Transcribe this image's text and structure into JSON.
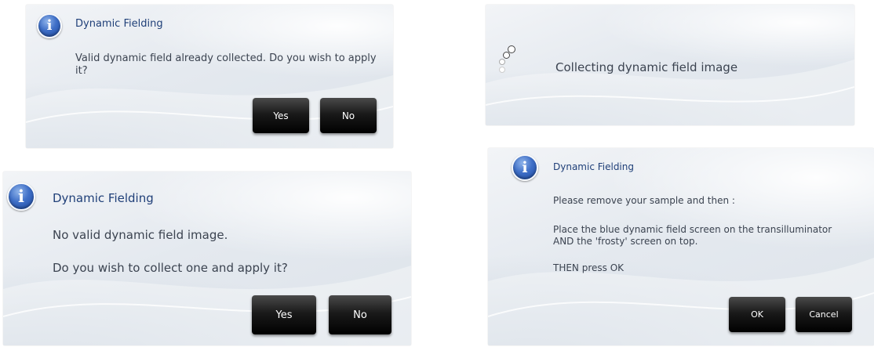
{
  "dialog_top_left": {
    "title": "Dynamic Fielding",
    "message": "Valid dynamic field already collected. Do you wish to apply it?",
    "yes_label": "Yes",
    "no_label": "No"
  },
  "dialog_top_right": {
    "message": "Collecting dynamic field image"
  },
  "dialog_bottom_left": {
    "title": "Dynamic Fielding",
    "message_1": "No valid dynamic field image.",
    "message_2": "Do you wish to collect one and apply it?",
    "yes_label": "Yes",
    "no_label": "No"
  },
  "dialog_bottom_right": {
    "title": "Dynamic Fielding",
    "message_1": "Please remove your sample and then :",
    "message_2": "Place the blue dynamic field screen on the transilluminator AND the 'frosty' screen on top.",
    "message_3": "THEN press OK",
    "ok_label": "OK",
    "cancel_label": "Cancel"
  },
  "icons": {
    "info_glyph": "i"
  },
  "colors": {
    "title": "#1f3f78",
    "button": "#111111",
    "dialog_bg": "#e6eaf0"
  }
}
